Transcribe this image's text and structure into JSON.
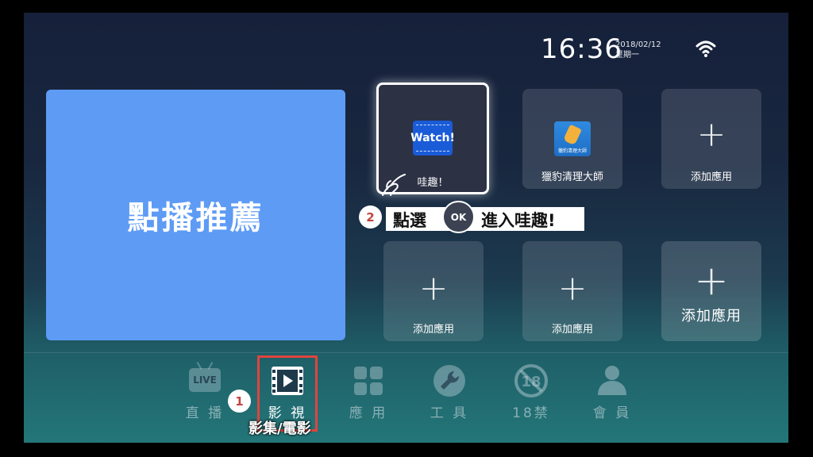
{
  "status": {
    "time": "16:36",
    "date": "2018/02/12",
    "weekday": "星期一",
    "wifi_icon": "wifi-icon"
  },
  "feature_tile": {
    "label": "點播推薦"
  },
  "apps": {
    "watch": {
      "icon_text": "Watch!",
      "label": "哇趣！"
    },
    "cleaner": {
      "icon_caption": "獵豹清理大師",
      "label": "獵豹清理大師"
    },
    "add_label": "添加應用",
    "add_symbol": "+"
  },
  "annotation": {
    "step2_number": "2",
    "step2_text_before": "點選",
    "ok_label": "OK",
    "step2_text_after": "進入哇趣!",
    "step1_number": "1",
    "step1_caption": "影集/電影"
  },
  "nav": {
    "live_badge": "LIVE",
    "items": [
      {
        "label": "直 播",
        "icon": "live-tv-icon"
      },
      {
        "label": "影 視",
        "icon": "film-icon",
        "active": true
      },
      {
        "label": "應 用",
        "icon": "apps-grid-icon"
      },
      {
        "label": "工 具",
        "icon": "wrench-icon"
      },
      {
        "label": "18禁",
        "icon": "age-18-icon"
      },
      {
        "label": "會 員",
        "icon": "user-icon"
      }
    ]
  },
  "colors": {
    "feature_blue": "#5d9bf5",
    "annotation_red": "#e0443e",
    "watch_blue": "#1a5bd8"
  }
}
